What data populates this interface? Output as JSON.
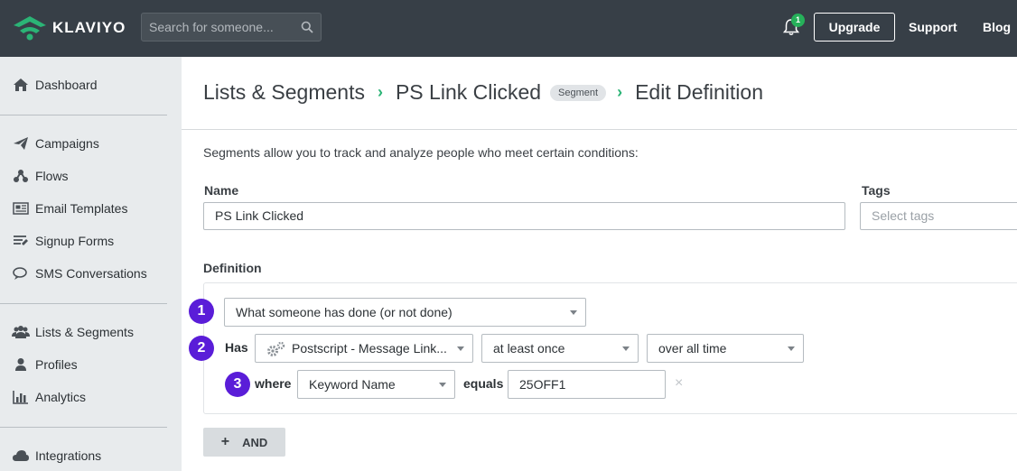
{
  "topbar": {
    "logo_text": "KLAVIYO",
    "search_placeholder": "Search for someone...",
    "notification_count": "1",
    "upgrade_label": "Upgrade",
    "support_label": "Support",
    "blog_label": "Blog"
  },
  "sidebar": {
    "items": [
      {
        "label": "Dashboard",
        "icon": "home-icon"
      },
      {
        "label": "Campaigns",
        "icon": "paper-plane-icon"
      },
      {
        "label": "Flows",
        "icon": "flow-icon"
      },
      {
        "label": "Email Templates",
        "icon": "newspaper-icon"
      },
      {
        "label": "Signup Forms",
        "icon": "form-list-icon"
      },
      {
        "label": "SMS Conversations",
        "icon": "chat-icon"
      },
      {
        "label": "Lists & Segments",
        "icon": "users-icon"
      },
      {
        "label": "Profiles",
        "icon": "user-icon"
      },
      {
        "label": "Analytics",
        "icon": "bar-chart-icon"
      },
      {
        "label": "Integrations",
        "icon": "cloud-icon"
      }
    ]
  },
  "breadcrumb": {
    "root": "Lists & Segments",
    "segment_name": "PS Link Clicked",
    "badge": "Segment",
    "current": "Edit Definition"
  },
  "intro_text": "Segments allow you to track and analyze people who meet certain conditions:",
  "form": {
    "name_label": "Name",
    "name_value": "PS Link Clicked",
    "tags_label": "Tags",
    "tags_placeholder": "Select tags",
    "definition_label": "Definition"
  },
  "conditions": {
    "step1_number": "1",
    "condition_type": "What someone has done (or not done)",
    "step2_number": "2",
    "has_label": "Has",
    "metric": "Postscript - Message Link...",
    "frequency": "at least once",
    "timeframe": "over all time",
    "step3_number": "3",
    "where_label": "where",
    "property": "Keyword Name",
    "operator": "equals",
    "value": "25OFF1",
    "remove_symbol": "×"
  },
  "and_button": "AND",
  "colors": {
    "topbar": "#373f47",
    "sidebar": "#e8ebed",
    "step_badge": "#5a1dd8",
    "breadcrumb_sep": "#2bb476"
  }
}
